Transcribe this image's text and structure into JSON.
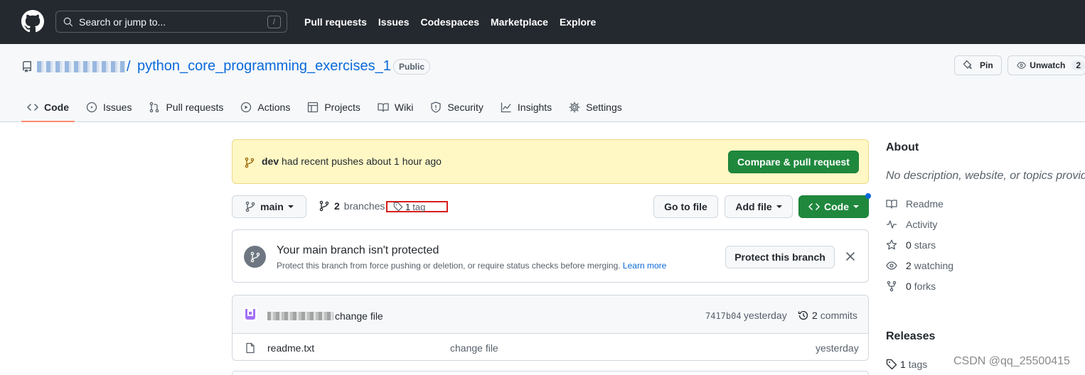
{
  "header": {
    "search_placeholder": "Search or jump to...",
    "search_shortcut": "/",
    "nav": [
      "Pull requests",
      "Issues",
      "Codespaces",
      "Marketplace",
      "Explore"
    ]
  },
  "repo": {
    "owner_suffix": "/",
    "name": "python_core_programming_exercises_1",
    "visibility": "Public",
    "pin_label": "Pin",
    "unwatch_label": "Unwatch",
    "watch_count": "2",
    "tabs": [
      "Code",
      "Issues",
      "Pull requests",
      "Actions",
      "Projects",
      "Wiki",
      "Security",
      "Insights",
      "Settings"
    ]
  },
  "banner": {
    "branch": "dev",
    "text": " had recent pushes about 1 hour ago",
    "button": "Compare & pull request"
  },
  "toolbar": {
    "branch": "main",
    "branches_count": "2",
    "branches_label": "branches",
    "tags_count": "1",
    "tags_label": "tag",
    "go_to_file": "Go to file",
    "add_file": "Add file",
    "code": "Code"
  },
  "protection": {
    "title": "Your main branch isn't protected",
    "description": "Protect this branch from force pushing or deletion, or require status checks before merging.",
    "learn_more": "Learn more",
    "button": "Protect this branch"
  },
  "commit": {
    "message": "change file",
    "sha": "7417b04",
    "when": "yesterday",
    "commits_count": "2",
    "commits_label": "commits"
  },
  "files": [
    {
      "name": "readme.txt",
      "message": "change file",
      "when": "yesterday"
    }
  ],
  "sidebar": {
    "about_heading": "About",
    "description": "No description, website, or topics provided.",
    "items": [
      {
        "icon": "book-icon",
        "count": "",
        "label": "Readme"
      },
      {
        "icon": "pulse-icon",
        "count": "",
        "label": "Activity"
      },
      {
        "icon": "star-icon",
        "count": "0",
        "label": "stars"
      },
      {
        "icon": "eye-icon",
        "count": "2",
        "label": "watching"
      },
      {
        "icon": "fork-icon",
        "count": "0",
        "label": "forks"
      }
    ],
    "releases_heading": "Releases",
    "release_tags_count": "1",
    "release_tags_label": "tags"
  },
  "watermark": "CSDN @qq_25500415",
  "colors": {
    "header_bg": "#24292f",
    "accent_green": "#1f883d",
    "link_blue": "#0969da",
    "banner_bg": "#fff8c5",
    "active_tab_underline": "#fd8c73",
    "highlight_red": "#d81e1e"
  }
}
